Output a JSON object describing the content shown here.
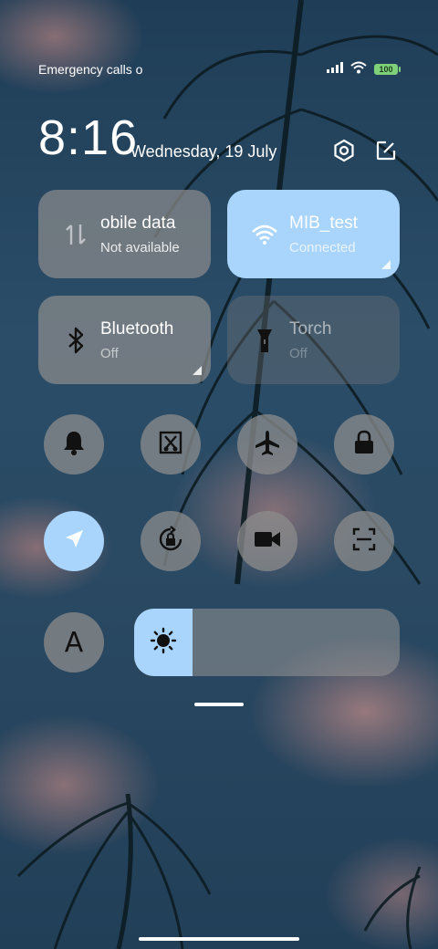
{
  "status": {
    "carrier": "Emergency calls o",
    "battery": "100",
    "icons": [
      "signal-icon",
      "wifi-icon",
      "battery-icon"
    ]
  },
  "header": {
    "time": "8:16",
    "date": "Wednesday, 19 July",
    "icons": [
      "settings-icon",
      "edit-icon"
    ]
  },
  "tiles": [
    {
      "title": "obile data",
      "subtitle": "Not available",
      "icon": "mobile-data-icon",
      "active": false
    },
    {
      "title": "MIB_test",
      "subtitle": "Connected",
      "icon": "wifi-icon",
      "active": true
    },
    {
      "title": "Bluetooth",
      "subtitle": "Off",
      "icon": "bluetooth-icon",
      "active": false
    },
    {
      "title": "Torch",
      "subtitle": "Off",
      "icon": "torch-icon",
      "active": false
    }
  ],
  "toggles_row1": [
    "bell-icon",
    "screenshot-icon",
    "airplane-icon",
    "lock-icon"
  ],
  "toggles_row2": [
    "location-icon",
    "auto-rotate-icon",
    "screen-record-icon",
    "scanner-icon"
  ],
  "font_toggle": {
    "label": "A",
    "icon": "font-size-icon"
  },
  "brightness": {
    "icon": "sun-icon",
    "level": 0.22
  },
  "colors": {
    "accent": "#a9d4fb",
    "tile": "#8c8c8c",
    "battery": "#7fd27a"
  }
}
